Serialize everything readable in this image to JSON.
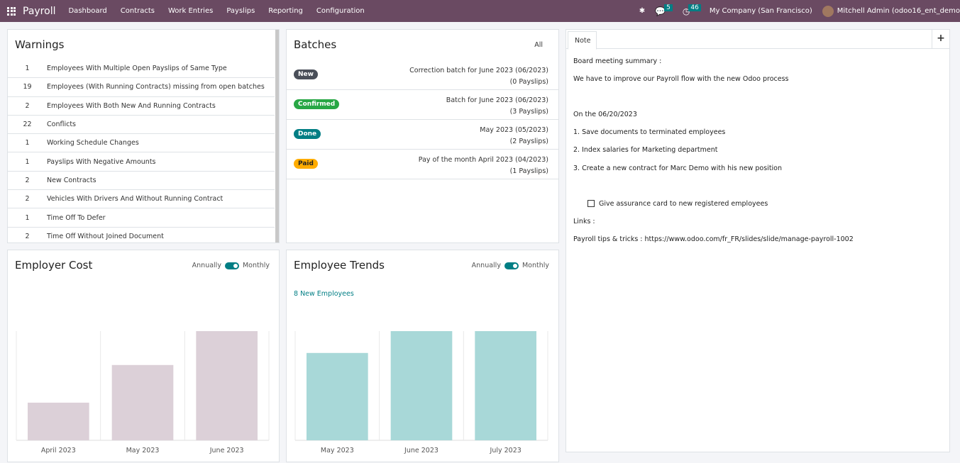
{
  "nav": {
    "app": "Payroll",
    "menus": [
      "Dashboard",
      "Contracts",
      "Work Entries",
      "Payslips",
      "Reporting",
      "Configuration"
    ],
    "messages": "5",
    "activities": "46",
    "company": "My Company (San Francisco)",
    "user": "Mitchell Admin (odoo16_ent_demo"
  },
  "warnings": {
    "title": "Warnings",
    "items": [
      {
        "count": "1",
        "label": "Employees With Multiple Open Payslips of Same Type"
      },
      {
        "count": "19",
        "label": "Employees (With Running Contracts) missing from open batches"
      },
      {
        "count": "2",
        "label": "Employees With Both New And Running Contracts"
      },
      {
        "count": "22",
        "label": "Conflicts"
      },
      {
        "count": "1",
        "label": "Working Schedule Changes"
      },
      {
        "count": "1",
        "label": "Payslips With Negative Amounts"
      },
      {
        "count": "2",
        "label": "New Contracts"
      },
      {
        "count": "2",
        "label": "Vehicles With Drivers And Without Running Contract"
      },
      {
        "count": "1",
        "label": "Time Off To Defer"
      },
      {
        "count": "2",
        "label": "Time Off Without Joined Document"
      }
    ]
  },
  "batches": {
    "title": "Batches",
    "all": "All",
    "items": [
      {
        "state": "New",
        "color": "#4a4f59",
        "name": "Correction batch for June 2023 (06/2023)",
        "count": "(0 Payslips)"
      },
      {
        "state": "Confirmed",
        "color": "#28a745",
        "name": "Batch for June 2023 (06/2023)",
        "count": "(3 Payslips)"
      },
      {
        "state": "Done",
        "color": "#017e84",
        "name": "May 2023 (05/2023)",
        "count": "(2 Payslips)"
      },
      {
        "state": "Paid",
        "color": "#ffac00",
        "name": "Pay of the month April 2023 (04/2023)",
        "count": "(1 Payslips)"
      }
    ]
  },
  "note": {
    "tab": "Note",
    "add": "+",
    "lines": [
      "Board meeting summary :",
      "We have to improve our Payroll flow with the new Odoo process",
      "On the 06/20/2023",
      "1. Save documents to terminated employees",
      "2. Index salaries for Marketing department",
      "3. Create a new contract for Marc Demo with his new position"
    ],
    "checkbox": "Give assurance card to new registered employees",
    "links": "Links :",
    "tips": "Payroll tips & tricks : https://www.odoo.com/fr_FR/slides/slide/manage-payroll-1002"
  },
  "toggle": {
    "annually": "Annually",
    "monthly": "Monthly"
  },
  "chart_data": [
    {
      "type": "bar",
      "title": "Employer Cost",
      "categories": [
        "April 2023",
        "May 2023",
        "June 2023"
      ],
      "values": [
        1,
        2,
        2.9
      ],
      "color": "#dcd0d8"
    },
    {
      "type": "bar",
      "title": "Employee Trends",
      "subtitle": "8 New Employees",
      "categories": [
        "May 2023",
        "June 2023",
        "July 2023"
      ],
      "values": [
        4,
        5,
        5
      ],
      "color": "#a8d8d8"
    }
  ]
}
